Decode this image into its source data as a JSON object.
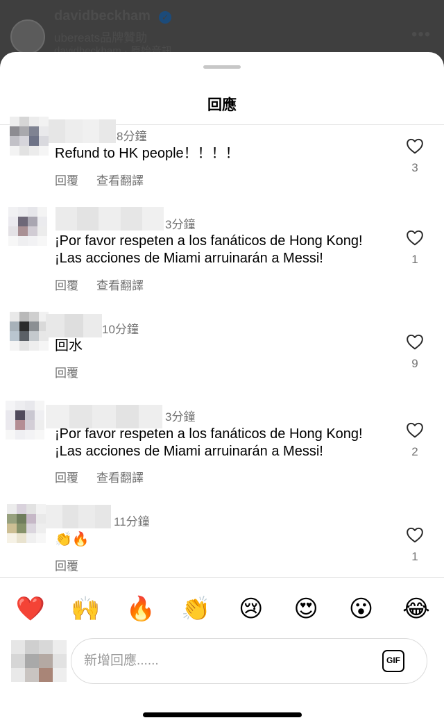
{
  "background_post": {
    "username": "davidbeckham",
    "sponsor": "ubereats品牌贊助",
    "audio": "davidbeckham · 原始音訊",
    "more": "•••"
  },
  "sheet": {
    "title": "回應"
  },
  "comments": [
    {
      "time": "8分鐘",
      "text": "Refund to HK people！！！！",
      "reply": "回覆",
      "translate": "查看翻譯",
      "likes": "3"
    },
    {
      "time": "3分鐘",
      "text_line1": "¡Por favor respeten a los fanáticos de Hong Kong!",
      "text_line2": "¡Las acciones de Miami arruinarán a Messi!",
      "reply": "回覆",
      "translate": "查看翻譯",
      "likes": "1"
    },
    {
      "time": "10分鐘",
      "text": "回水",
      "reply": "回覆",
      "likes": "9"
    },
    {
      "time": "3分鐘",
      "text_line1": "¡Por favor respeten a los fanáticos de Hong Kong!",
      "text_line2": "¡Las acciones de Miami arruinarán a Messi!",
      "reply": "回覆",
      "translate": "查看翻譯",
      "likes": "2"
    },
    {
      "time": "11分鐘",
      "text": "👏🔥",
      "reply": "回覆",
      "likes": "1"
    }
  ],
  "emoji_bar": [
    "❤️",
    "🙌",
    "🔥",
    "👏",
    "😢",
    "😍",
    "😮",
    "😂"
  ],
  "composer": {
    "placeholder": "新增回應......",
    "gif_label": "GIF"
  },
  "colors": {
    "secondary_text": "#737373",
    "divider": "#e6e6e6",
    "scrim": "#4a4a4a"
  }
}
